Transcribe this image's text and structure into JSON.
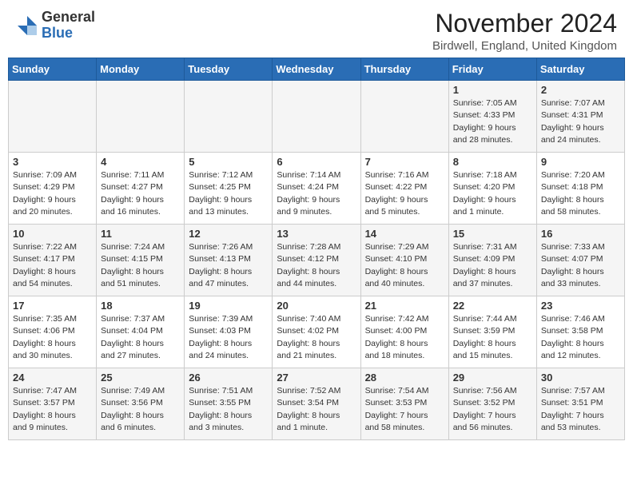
{
  "header": {
    "logo_general": "General",
    "logo_blue": "Blue",
    "month_title": "November 2024",
    "location": "Birdwell, England, United Kingdom"
  },
  "days_of_week": [
    "Sunday",
    "Monday",
    "Tuesday",
    "Wednesday",
    "Thursday",
    "Friday",
    "Saturday"
  ],
  "weeks": [
    [
      {
        "day": "",
        "info": ""
      },
      {
        "day": "",
        "info": ""
      },
      {
        "day": "",
        "info": ""
      },
      {
        "day": "",
        "info": ""
      },
      {
        "day": "",
        "info": ""
      },
      {
        "day": "1",
        "info": "Sunrise: 7:05 AM\nSunset: 4:33 PM\nDaylight: 9 hours\nand 28 minutes."
      },
      {
        "day": "2",
        "info": "Sunrise: 7:07 AM\nSunset: 4:31 PM\nDaylight: 9 hours\nand 24 minutes."
      }
    ],
    [
      {
        "day": "3",
        "info": "Sunrise: 7:09 AM\nSunset: 4:29 PM\nDaylight: 9 hours\nand 20 minutes."
      },
      {
        "day": "4",
        "info": "Sunrise: 7:11 AM\nSunset: 4:27 PM\nDaylight: 9 hours\nand 16 minutes."
      },
      {
        "day": "5",
        "info": "Sunrise: 7:12 AM\nSunset: 4:25 PM\nDaylight: 9 hours\nand 13 minutes."
      },
      {
        "day": "6",
        "info": "Sunrise: 7:14 AM\nSunset: 4:24 PM\nDaylight: 9 hours\nand 9 minutes."
      },
      {
        "day": "7",
        "info": "Sunrise: 7:16 AM\nSunset: 4:22 PM\nDaylight: 9 hours\nand 5 minutes."
      },
      {
        "day": "8",
        "info": "Sunrise: 7:18 AM\nSunset: 4:20 PM\nDaylight: 9 hours\nand 1 minute."
      },
      {
        "day": "9",
        "info": "Sunrise: 7:20 AM\nSunset: 4:18 PM\nDaylight: 8 hours\nand 58 minutes."
      }
    ],
    [
      {
        "day": "10",
        "info": "Sunrise: 7:22 AM\nSunset: 4:17 PM\nDaylight: 8 hours\nand 54 minutes."
      },
      {
        "day": "11",
        "info": "Sunrise: 7:24 AM\nSunset: 4:15 PM\nDaylight: 8 hours\nand 51 minutes."
      },
      {
        "day": "12",
        "info": "Sunrise: 7:26 AM\nSunset: 4:13 PM\nDaylight: 8 hours\nand 47 minutes."
      },
      {
        "day": "13",
        "info": "Sunrise: 7:28 AM\nSunset: 4:12 PM\nDaylight: 8 hours\nand 44 minutes."
      },
      {
        "day": "14",
        "info": "Sunrise: 7:29 AM\nSunset: 4:10 PM\nDaylight: 8 hours\nand 40 minutes."
      },
      {
        "day": "15",
        "info": "Sunrise: 7:31 AM\nSunset: 4:09 PM\nDaylight: 8 hours\nand 37 minutes."
      },
      {
        "day": "16",
        "info": "Sunrise: 7:33 AM\nSunset: 4:07 PM\nDaylight: 8 hours\nand 33 minutes."
      }
    ],
    [
      {
        "day": "17",
        "info": "Sunrise: 7:35 AM\nSunset: 4:06 PM\nDaylight: 8 hours\nand 30 minutes."
      },
      {
        "day": "18",
        "info": "Sunrise: 7:37 AM\nSunset: 4:04 PM\nDaylight: 8 hours\nand 27 minutes."
      },
      {
        "day": "19",
        "info": "Sunrise: 7:39 AM\nSunset: 4:03 PM\nDaylight: 8 hours\nand 24 minutes."
      },
      {
        "day": "20",
        "info": "Sunrise: 7:40 AM\nSunset: 4:02 PM\nDaylight: 8 hours\nand 21 minutes."
      },
      {
        "day": "21",
        "info": "Sunrise: 7:42 AM\nSunset: 4:00 PM\nDaylight: 8 hours\nand 18 minutes."
      },
      {
        "day": "22",
        "info": "Sunrise: 7:44 AM\nSunset: 3:59 PM\nDaylight: 8 hours\nand 15 minutes."
      },
      {
        "day": "23",
        "info": "Sunrise: 7:46 AM\nSunset: 3:58 PM\nDaylight: 8 hours\nand 12 minutes."
      }
    ],
    [
      {
        "day": "24",
        "info": "Sunrise: 7:47 AM\nSunset: 3:57 PM\nDaylight: 8 hours\nand 9 minutes."
      },
      {
        "day": "25",
        "info": "Sunrise: 7:49 AM\nSunset: 3:56 PM\nDaylight: 8 hours\nand 6 minutes."
      },
      {
        "day": "26",
        "info": "Sunrise: 7:51 AM\nSunset: 3:55 PM\nDaylight: 8 hours\nand 3 minutes."
      },
      {
        "day": "27",
        "info": "Sunrise: 7:52 AM\nSunset: 3:54 PM\nDaylight: 8 hours\nand 1 minute."
      },
      {
        "day": "28",
        "info": "Sunrise: 7:54 AM\nSunset: 3:53 PM\nDaylight: 7 hours\nand 58 minutes."
      },
      {
        "day": "29",
        "info": "Sunrise: 7:56 AM\nSunset: 3:52 PM\nDaylight: 7 hours\nand 56 minutes."
      },
      {
        "day": "30",
        "info": "Sunrise: 7:57 AM\nSunset: 3:51 PM\nDaylight: 7 hours\nand 53 minutes."
      }
    ]
  ]
}
